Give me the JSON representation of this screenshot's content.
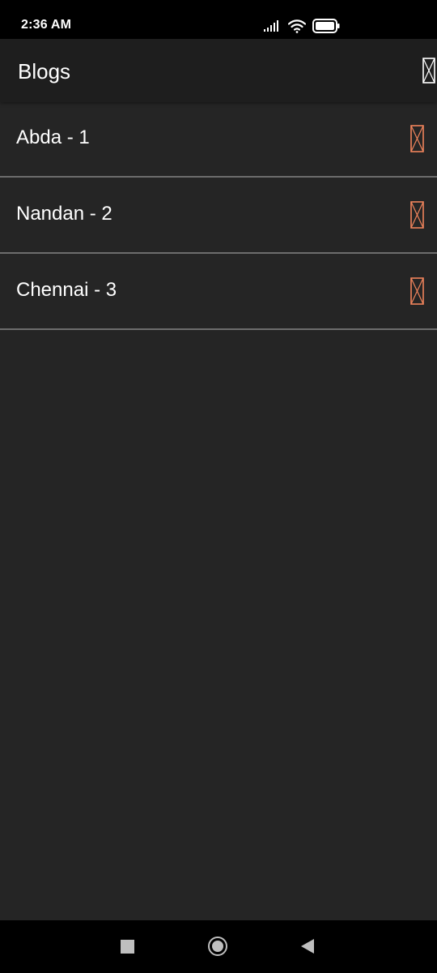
{
  "status_bar": {
    "time": "2:36 AM",
    "icons": [
      "signal-icon",
      "wifi-icon",
      "battery-icon"
    ]
  },
  "app_bar": {
    "title": "Blogs",
    "action_icon": "add-icon"
  },
  "blogs": {
    "items": [
      {
        "label": "Abda - 1",
        "icon": "delete-icon"
      },
      {
        "label": "Nandan - 2",
        "icon": "delete-icon"
      },
      {
        "label": "Chennai - 3",
        "icon": "delete-icon"
      }
    ]
  },
  "nav_bar": {
    "buttons": [
      "recents-icon",
      "home-icon",
      "back-icon"
    ]
  },
  "colors": {
    "background": "#252525",
    "app_bar": "#1e1e1e",
    "item_icon": "#f0845c",
    "divider": "#6d6d6d",
    "text": "#ffffff"
  }
}
